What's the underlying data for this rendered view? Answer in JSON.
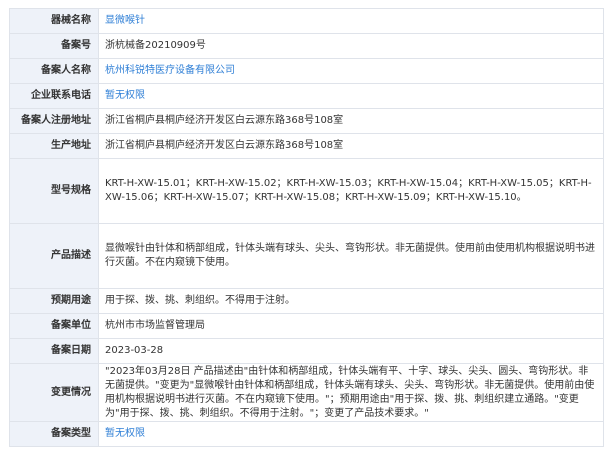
{
  "rows": [
    {
      "label": "器械名称",
      "value": "显微喉针",
      "link": true
    },
    {
      "label": "备案号",
      "value": "浙杭械备20210909号",
      "link": false
    },
    {
      "label": "备案人名称",
      "value": "杭州科锐特医疗设备有限公司",
      "link": true
    },
    {
      "label": "企业联系电话",
      "value": "暂无权限",
      "link": true
    },
    {
      "label": "备案人注册地址",
      "value": "浙江省桐庐县桐庐经济开发区白云源东路368号108室",
      "link": false
    },
    {
      "label": "生产地址",
      "value": "浙江省桐庐县桐庐经济开发区白云源东路368号108室",
      "link": false
    },
    {
      "label": "型号规格",
      "value": "KRT-H-XW-15.01；KRT-H-XW-15.02；KRT-H-XW-15.03；KRT-H-XW-15.04；KRT-H-XW-15.05；KRT-H-XW-15.06；KRT-H-XW-15.07；KRT-H-XW-15.08；KRT-H-XW-15.09；KRT-H-XW-15.10。",
      "link": false
    },
    {
      "label": "产品描述",
      "value": "显微喉针由针体和柄部组成，针体头端有球头、尖头、弯钩形状。非无菌提供。使用前由使用机构根据说明书进行灭菌。不在内窥镜下使用。",
      "link": false
    },
    {
      "label": "预期用途",
      "value": "用于探、拨、挑、刺组织。不得用于注射。",
      "link": false
    },
    {
      "label": "备案单位",
      "value": "杭州市市场监督管理局",
      "link": false
    },
    {
      "label": "备案日期",
      "value": "2023-03-28",
      "link": false
    },
    {
      "label": "变更情况",
      "value": "\"2023年03月28日 产品描述由\"由针体和柄部组成，针体头端有平、十字、球头、尖头、圆头、弯钩形状。非无菌提供。\"变更为\"显微喉针由针体和柄部组成，针体头端有球头、尖头、弯钩形状。非无菌提供。使用前由使用机构根据说明书进行灭菌。不在内窥镜下使用。\"；预期用途由\"用于探、拨、挑、刺组织建立通路。\"变更为\"用于探、拨、挑、刺组织。不得用于注射。\"；变更了产品技术要求。\"",
      "link": false
    },
    {
      "label": "备案类型",
      "value": "暂无权限",
      "link": true
    }
  ]
}
